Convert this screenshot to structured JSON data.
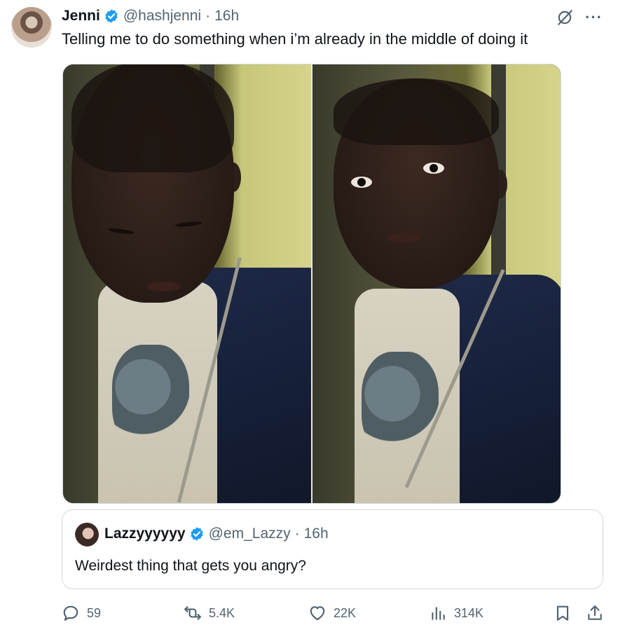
{
  "author": {
    "name": "Jenni",
    "handle": "@hashjenni",
    "separator": "·",
    "time": "16h"
  },
  "tweet_text": "Telling me to do something when i’m already in the middle of doing it",
  "quoted": {
    "name": "Lazzyyyyyy",
    "handle": "@em_Lazzy",
    "separator": "·",
    "time": "16h",
    "text": "Weirdest thing that gets you angry?"
  },
  "stats": {
    "replies": "59",
    "reposts": "5.4K",
    "likes": "22K",
    "views": "314K"
  },
  "colors": {
    "verified": "#1d9bf0",
    "muted": "#536471",
    "border": "#cfd9de"
  },
  "icons": {
    "verified": "verified-badge-icon",
    "grok": "grok-icon",
    "more": "more-icon",
    "reply": "reply-icon",
    "repost": "repost-icon",
    "like": "like-icon",
    "views": "views-icon",
    "bookmark": "bookmark-icon",
    "share": "share-icon"
  }
}
